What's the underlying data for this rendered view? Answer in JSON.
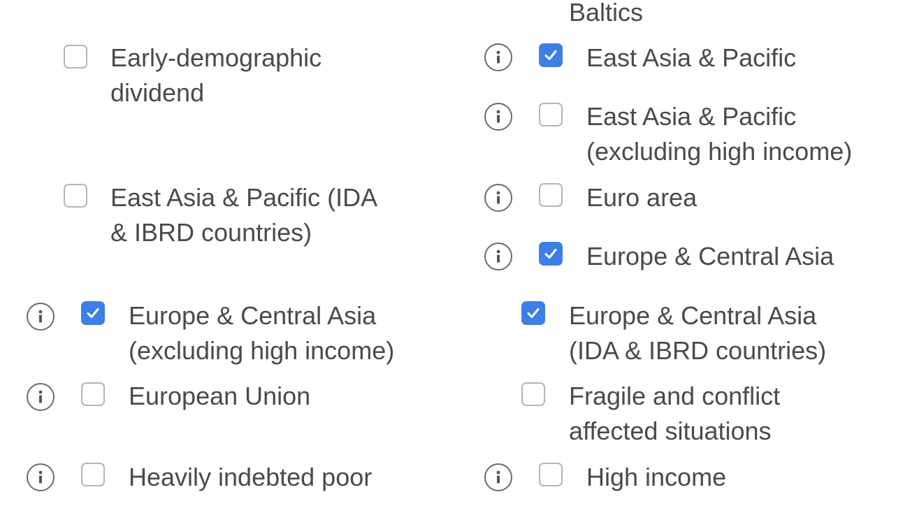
{
  "top_fragment": "Baltics",
  "left_column": [
    {
      "label": "Early-demographic dividend",
      "line1": "Early-demographic",
      "line2": "dividend",
      "checked": false,
      "has_info": false
    },
    {
      "label": "East Asia & Pacific (IDA & IBRD countries)",
      "line1": "East Asia & Pacific (IDA",
      "line2": "& IBRD countries)",
      "checked": false,
      "has_info": false
    },
    {
      "label": "Europe & Central Asia (excluding high income)",
      "line1": "Europe & Central Asia",
      "line2": "(excluding high income)",
      "checked": true,
      "has_info": true
    },
    {
      "label": "European Union",
      "line1": "European Union",
      "line2": "",
      "checked": false,
      "has_info": true
    },
    {
      "label": "Heavily indebted poor",
      "line1": "Heavily indebted poor",
      "line2": "",
      "checked": false,
      "has_info": true
    }
  ],
  "right_column": [
    {
      "label": "East Asia & Pacific",
      "line1": "East Asia & Pacific",
      "line2": "",
      "checked": true,
      "has_info": true
    },
    {
      "label": "East Asia & Pacific (excluding high income)",
      "line1": "East Asia & Pacific",
      "line2": "(excluding high income)",
      "checked": false,
      "has_info": true
    },
    {
      "label": "Euro area",
      "line1": "Euro area",
      "line2": "",
      "checked": false,
      "has_info": true
    },
    {
      "label": "Europe & Central Asia",
      "line1": "Europe & Central Asia",
      "line2": "",
      "checked": true,
      "has_info": true
    },
    {
      "label": "Europe & Central Asia (IDA & IBRD countries)",
      "line1": "Europe & Central Asia",
      "line2": "(IDA & IBRD countries)",
      "checked": true,
      "has_info": false
    },
    {
      "label": "Fragile and conflict affected situations",
      "line1": "Fragile and conflict",
      "line2": "affected situations",
      "checked": false,
      "has_info": false
    },
    {
      "label": "High income",
      "line1": "High income",
      "line2": "",
      "checked": false,
      "has_info": true
    }
  ],
  "colors": {
    "checked": "#3d7fe6",
    "text": "#4a4a4a",
    "border": "#b5b5b5",
    "icon": "#6b6b6b"
  },
  "icons": {
    "info": "info-circle-icon",
    "check": "checkmark-icon"
  }
}
